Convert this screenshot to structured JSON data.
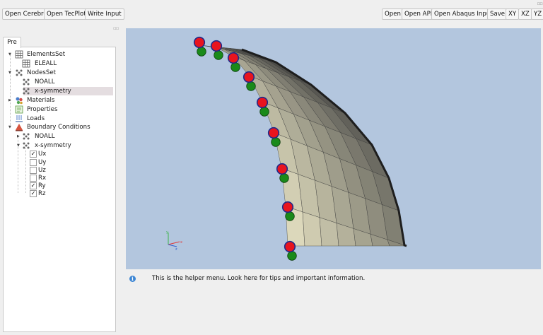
{
  "toolbar_left": {
    "open_cerebro": "Open Cerebro",
    "open_tecplot": "Open TecPlot",
    "write_input": "Write Input"
  },
  "toolbar_right": {
    "open": "Open",
    "open_api": "Open API",
    "open_abaqus_input": "Open Abaqus Input",
    "save": "Save",
    "xy": "XY",
    "xz": "XZ",
    "yz": "YZ"
  },
  "tabs": {
    "pre": "Pre"
  },
  "tree": {
    "elements_set": "ElementsSet",
    "eleall": "ELEALL",
    "nodes_set": "NodesSet",
    "noall": "NOALL",
    "x_symmetry": "x-symmetry",
    "materials": "Materials",
    "properties": "Properties",
    "loads": "Loads",
    "boundary_conditions": "Boundary Conditions",
    "bc_noall": "NOALL",
    "bc_x_symmetry": "x-symmetry",
    "dofs": [
      {
        "label": "Ux",
        "checked": true
      },
      {
        "label": "Uy",
        "checked": false
      },
      {
        "label": "Uz",
        "checked": false
      },
      {
        "label": "Rx",
        "checked": false
      },
      {
        "label": "Ry",
        "checked": true
      },
      {
        "label": "Rz",
        "checked": true
      }
    ],
    "selected": "x-symmetry"
  },
  "viewport": {
    "background": "#b3c6de",
    "node_color_red": "#e8141e",
    "node_color_green": "#1a8a1a",
    "node_outline": "#1f2a8a",
    "mesh_light": "#dcd8bb",
    "mesh_dark": "#4a4a47",
    "axis_labels": {
      "y": "y",
      "z": "z",
      "x": "x"
    }
  },
  "helper": {
    "info_glyph": "i",
    "text": "This is the helper menu. Look here for tips and important information."
  }
}
